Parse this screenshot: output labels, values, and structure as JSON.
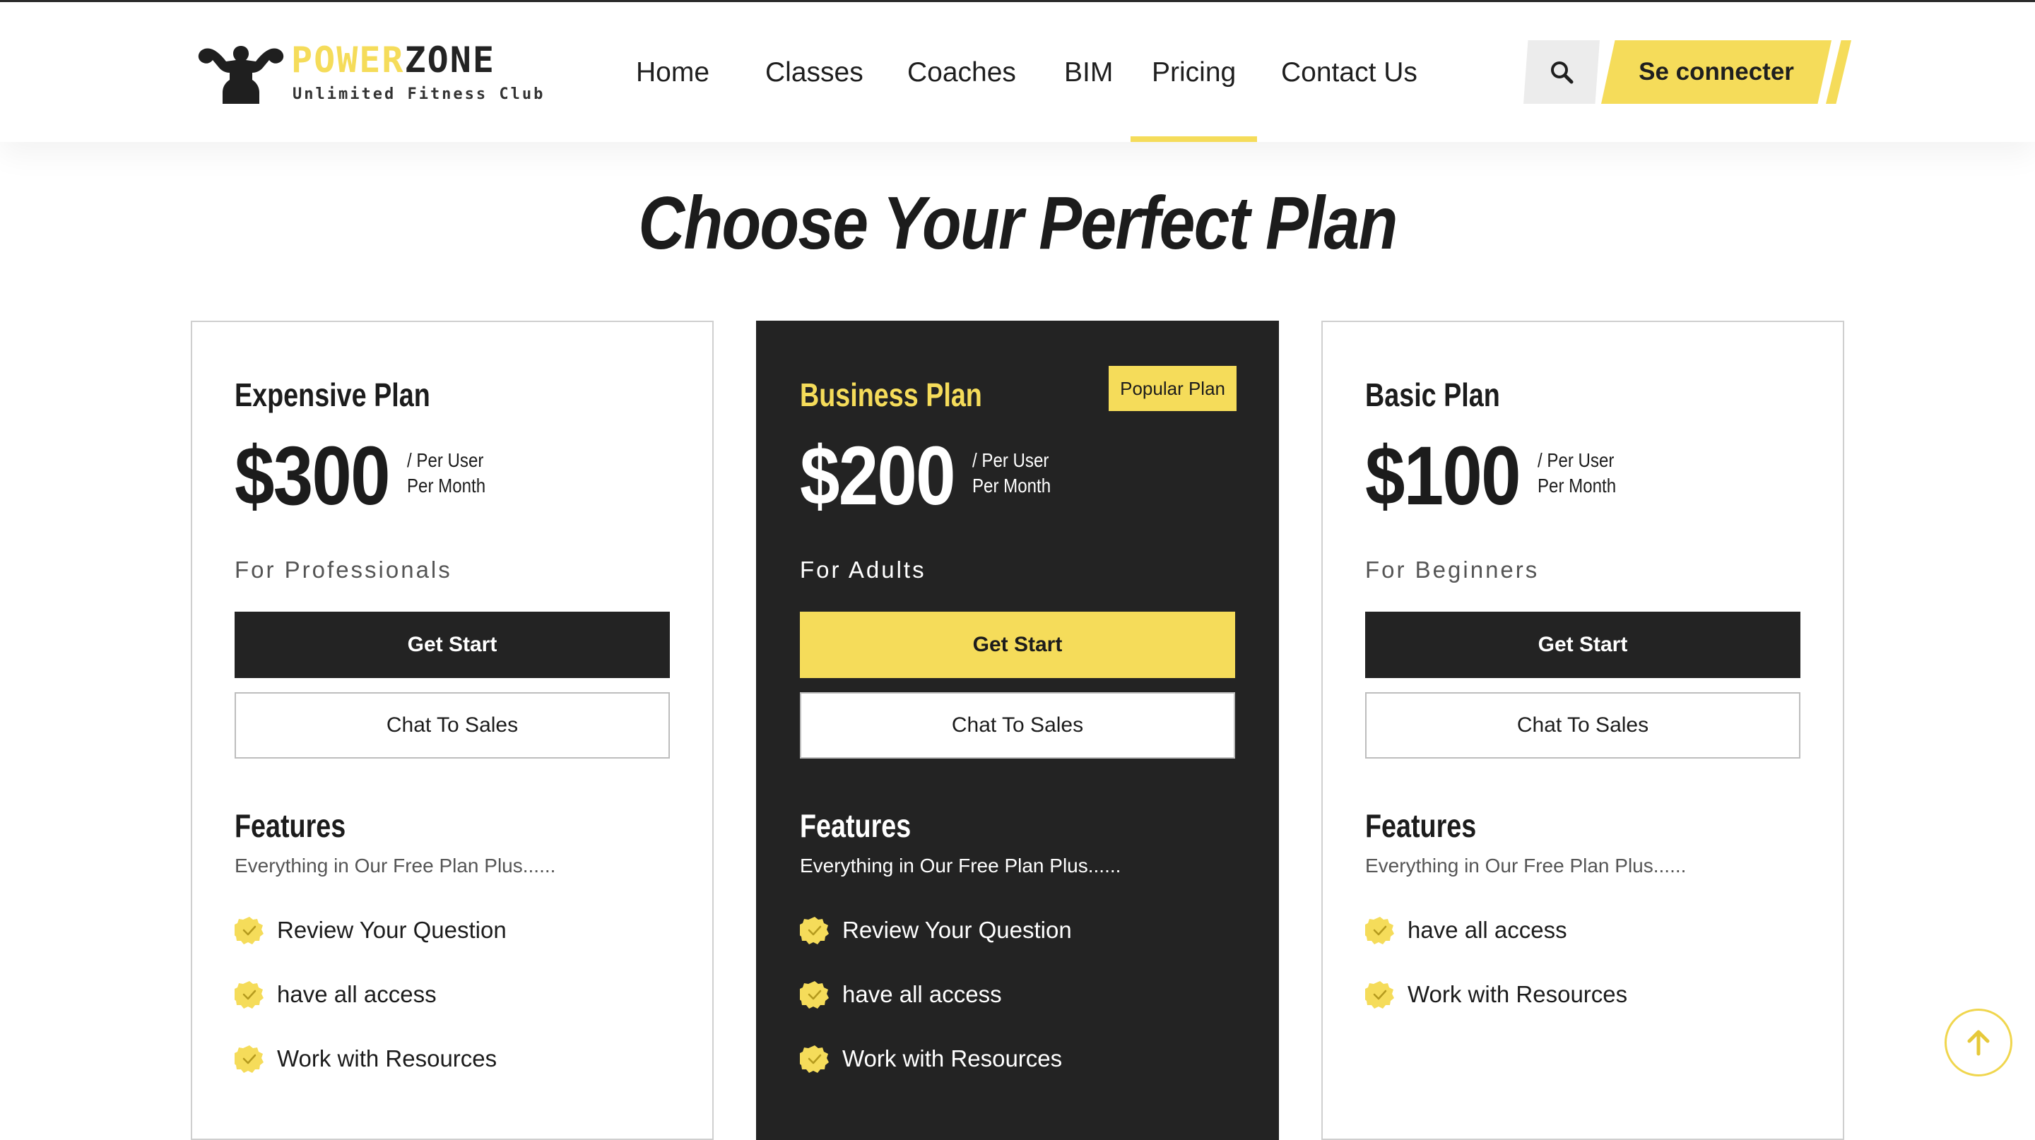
{
  "brand": {
    "name_part1": "POWER",
    "name_part2": "ZONE",
    "tagline": "Unlimited Fitness Club"
  },
  "nav": {
    "items": [
      {
        "label": "Home",
        "active": false
      },
      {
        "label": "Classes",
        "active": false
      },
      {
        "label": "Coaches",
        "active": false
      },
      {
        "label": "BIM",
        "active": false
      },
      {
        "label": "Pricing",
        "active": true
      },
      {
        "label": "Contact Us",
        "active": false
      }
    ],
    "search_icon": "search-icon",
    "login_label": "Se connecter"
  },
  "page": {
    "title": "Choose Your Perfect Plan"
  },
  "plans": [
    {
      "name": "Expensive Plan",
      "price": "$300",
      "per_line1": "/ Per User",
      "per_line2": "Per Month",
      "audience": "For Professionals",
      "start_label": "Get Start",
      "sales_label": "Chat To Sales",
      "features_title": "Features",
      "features_subtitle": "Everything in Our Free Plan Plus......",
      "features": [
        "Review Your Question",
        "have all access",
        "Work with Resources"
      ]
    },
    {
      "name": "Business Plan",
      "badge": "Popular Plan",
      "price": "$200",
      "per_line1": "/ Per User",
      "per_line2": "Per Month",
      "audience": "For Adults",
      "start_label": "Get Start",
      "sales_label": "Chat To Sales",
      "features_title": "Features",
      "features_subtitle": "Everything in Our Free Plan Plus......",
      "features": [
        "Review Your Question",
        "have all access",
        "Work with Resources"
      ]
    },
    {
      "name": "Basic Plan",
      "price": "$100",
      "per_line1": "/ Per User",
      "per_line2": "Per Month",
      "audience": "For Beginners",
      "start_label": "Get Start",
      "sales_label": "Chat To Sales",
      "features_title": "Features",
      "features_subtitle": "Everything in Our Free Plan Plus......",
      "features": [
        "have all access",
        "Work with Resources"
      ]
    }
  ],
  "icons": {
    "check": "check-badge-icon",
    "scroll_top": "arrow-up-icon"
  },
  "colors": {
    "accent": "#f5dc5a",
    "dark": "#232323",
    "text": "#1c1c1c"
  }
}
